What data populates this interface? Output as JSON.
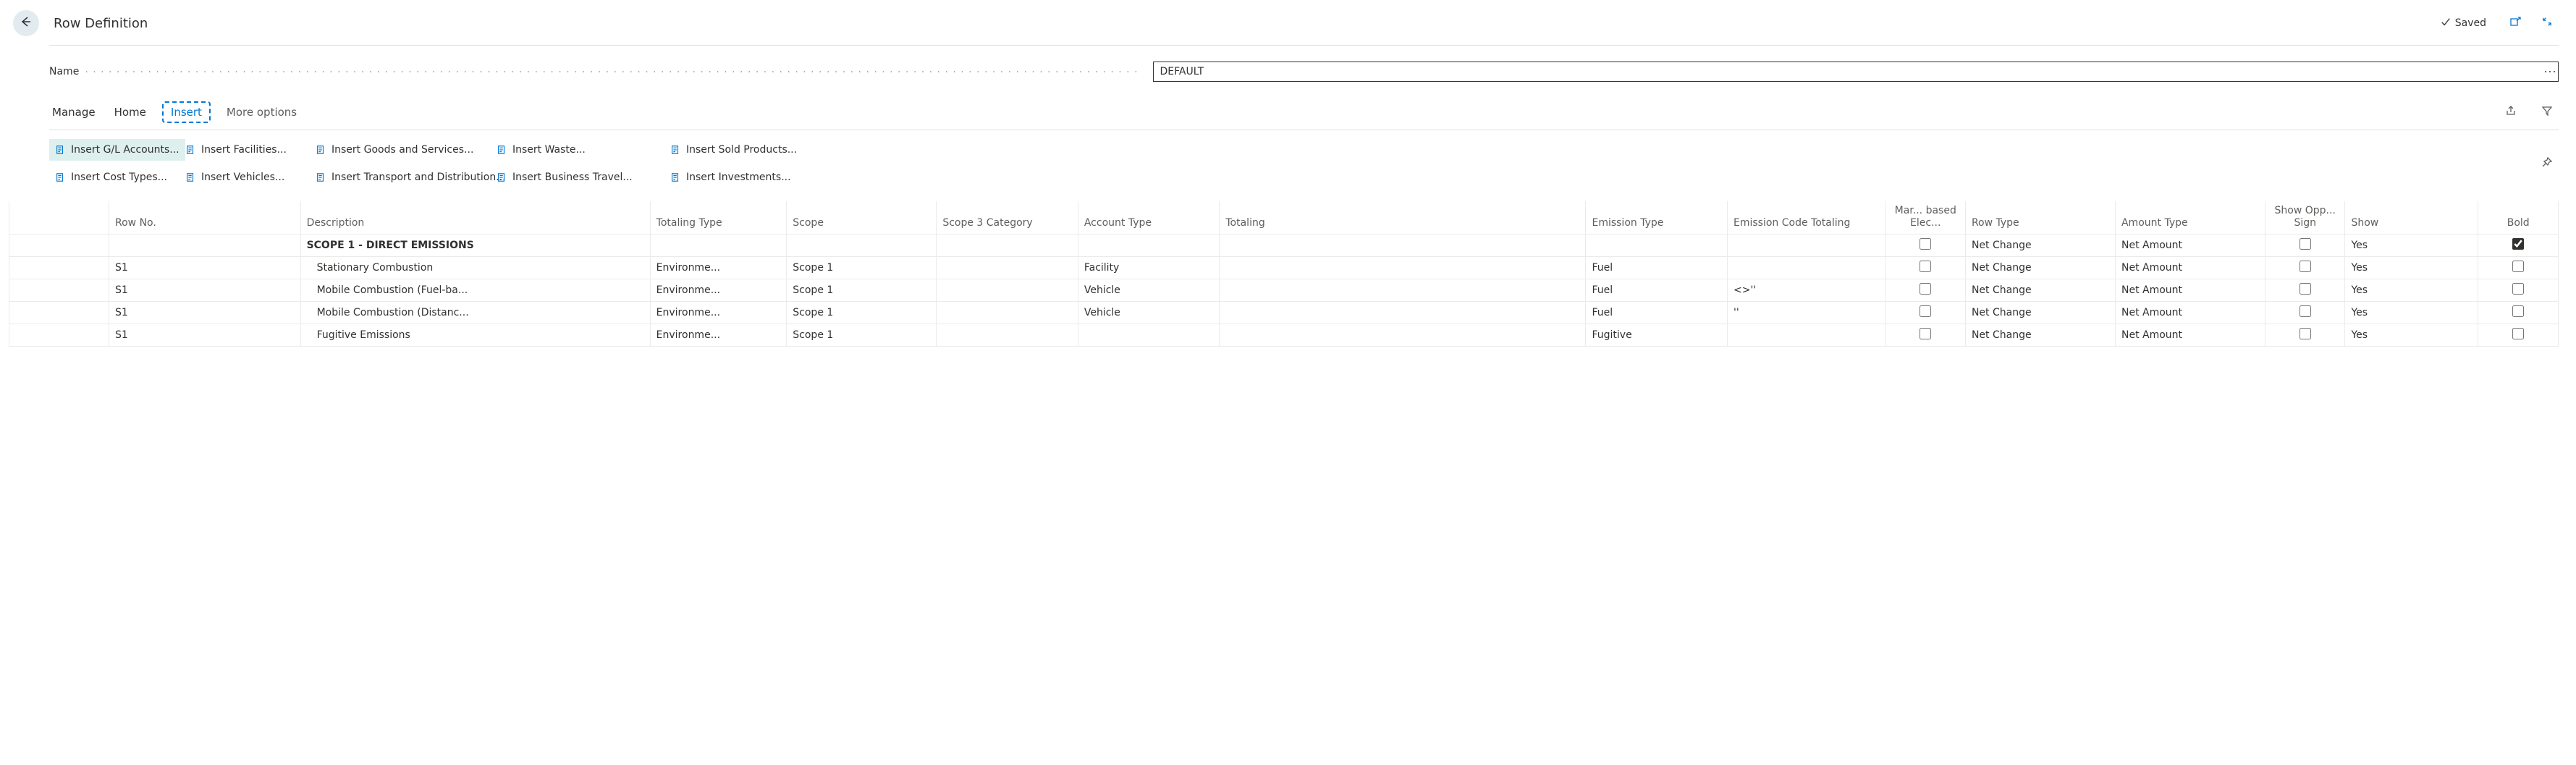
{
  "header": {
    "page_title": "Row Definition",
    "saved_label": "Saved"
  },
  "form": {
    "name_label": "Name",
    "name_value": "DEFAULT"
  },
  "tabs": {
    "manage": "Manage",
    "home": "Home",
    "insert": "Insert",
    "more": "More options"
  },
  "ribbon": {
    "insert_gl": "Insert G/L Accounts...",
    "insert_facilities": "Insert Facilities...",
    "insert_goods": "Insert Goods and Services...",
    "insert_waste": "Insert Waste...",
    "insert_sold": "Insert Sold Products...",
    "insert_cost": "Insert Cost Types...",
    "insert_vehicles": "Insert Vehicles...",
    "insert_transport": "Insert Transport and Distribution...",
    "insert_travel": "Insert Business Travel...",
    "insert_invest": "Insert Investments..."
  },
  "grid": {
    "columns": {
      "row_no": "Row No.",
      "description": "Description",
      "totaling_type": "Totaling Type",
      "scope": "Scope",
      "scope3_cat": "Scope 3 Category",
      "account_type": "Account Type",
      "totaling": "Totaling",
      "emission_type": "Emission Type",
      "emission_code_totaling": "Emission Code Totaling",
      "market_based_elec": "Mar... based Elec...",
      "row_type": "Row Type",
      "amount_type": "Amount Type",
      "show_opp_sign": "Show Opp... Sign",
      "show": "Show",
      "bold": "Bold"
    },
    "rows": [
      {
        "row_no": "",
        "description": "SCOPE 1 - DIRECT EMISSIONS",
        "totaling_type": "",
        "scope": "",
        "scope3_cat": "",
        "account_type": "",
        "totaling": "",
        "emission_type": "",
        "emission_code_totaling": "",
        "market_based_elec": false,
        "row_type": "Net Change",
        "amount_type": "Net Amount",
        "show_opp_sign": false,
        "show": "Yes",
        "bold": true,
        "is_bold_row": true
      },
      {
        "row_no": "S1",
        "description": "Stationary Combustion",
        "totaling_type": "Environme...",
        "scope": "Scope 1",
        "scope3_cat": "",
        "account_type": "Facility",
        "totaling": "",
        "emission_type": "Fuel",
        "emission_code_totaling": "",
        "market_based_elec": false,
        "row_type": "Net Change",
        "amount_type": "Net Amount",
        "show_opp_sign": false,
        "show": "Yes",
        "bold": false,
        "is_bold_row": false
      },
      {
        "row_no": "S1",
        "description": "Mobile Combustion (Fuel-ba...",
        "totaling_type": "Environme...",
        "scope": "Scope 1",
        "scope3_cat": "",
        "account_type": "Vehicle",
        "totaling": "",
        "emission_type": "Fuel",
        "emission_code_totaling": "<>''",
        "market_based_elec": false,
        "row_type": "Net Change",
        "amount_type": "Net Amount",
        "show_opp_sign": false,
        "show": "Yes",
        "bold": false,
        "is_bold_row": false
      },
      {
        "row_no": "S1",
        "description": "Mobile Combustion (Distanc...",
        "totaling_type": "Environme...",
        "scope": "Scope 1",
        "scope3_cat": "",
        "account_type": "Vehicle",
        "totaling": "",
        "emission_type": "Fuel",
        "emission_code_totaling": "''",
        "market_based_elec": false,
        "row_type": "Net Change",
        "amount_type": "Net Amount",
        "show_opp_sign": false,
        "show": "Yes",
        "bold": false,
        "is_bold_row": false
      },
      {
        "row_no": "S1",
        "description": "Fugitive Emissions",
        "totaling_type": "Environme...",
        "scope": "Scope 1",
        "scope3_cat": "",
        "account_type": "",
        "totaling": "",
        "emission_type": "Fugitive",
        "emission_code_totaling": "",
        "market_based_elec": false,
        "row_type": "Net Change",
        "amount_type": "Net Amount",
        "show_opp_sign": false,
        "show": "Yes",
        "bold": false,
        "is_bold_row": false
      }
    ]
  }
}
